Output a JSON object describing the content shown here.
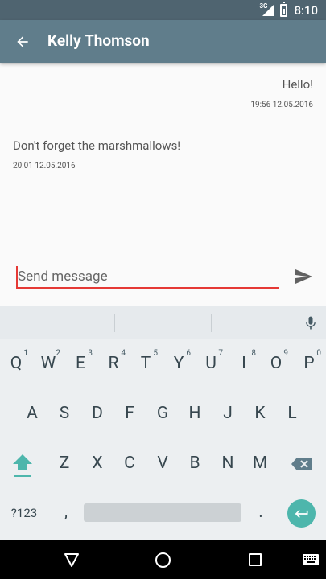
{
  "status_bar": {
    "network": "3G",
    "time": "8:10"
  },
  "app_bar": {
    "title": "Kelly Thomson",
    "back_icon": "arrow-back-icon"
  },
  "messages": [
    {
      "direction": "outgoing",
      "text": "Hello!",
      "time": "19:56 12.05.2016"
    },
    {
      "direction": "incoming",
      "text": "Don't forget the marshmallows!",
      "time": "20:01 12.05.2016"
    }
  ],
  "compose": {
    "placeholder": "Send message",
    "value": "",
    "send_icon": "send-icon",
    "accent_color": "#e53935"
  },
  "keyboard": {
    "row1": [
      {
        "key": "Q",
        "hint": "1"
      },
      {
        "key": "W",
        "hint": "2"
      },
      {
        "key": "E",
        "hint": "3"
      },
      {
        "key": "R",
        "hint": "4"
      },
      {
        "key": "T",
        "hint": "5"
      },
      {
        "key": "Y",
        "hint": "6"
      },
      {
        "key": "U",
        "hint": "7"
      },
      {
        "key": "I",
        "hint": "8"
      },
      {
        "key": "O",
        "hint": "9"
      },
      {
        "key": "P",
        "hint": "0"
      }
    ],
    "row2": [
      "A",
      "S",
      "D",
      "F",
      "G",
      "H",
      "J",
      "K",
      "L"
    ],
    "row3": [
      "Z",
      "X",
      "C",
      "V",
      "B",
      "N",
      "M"
    ],
    "symbols_label": "?123",
    "comma": ",",
    "period": ".",
    "enter_color": "#4db6ac"
  },
  "colors": {
    "app_bar": "#607d8b",
    "status_bar": "#4f6470"
  }
}
